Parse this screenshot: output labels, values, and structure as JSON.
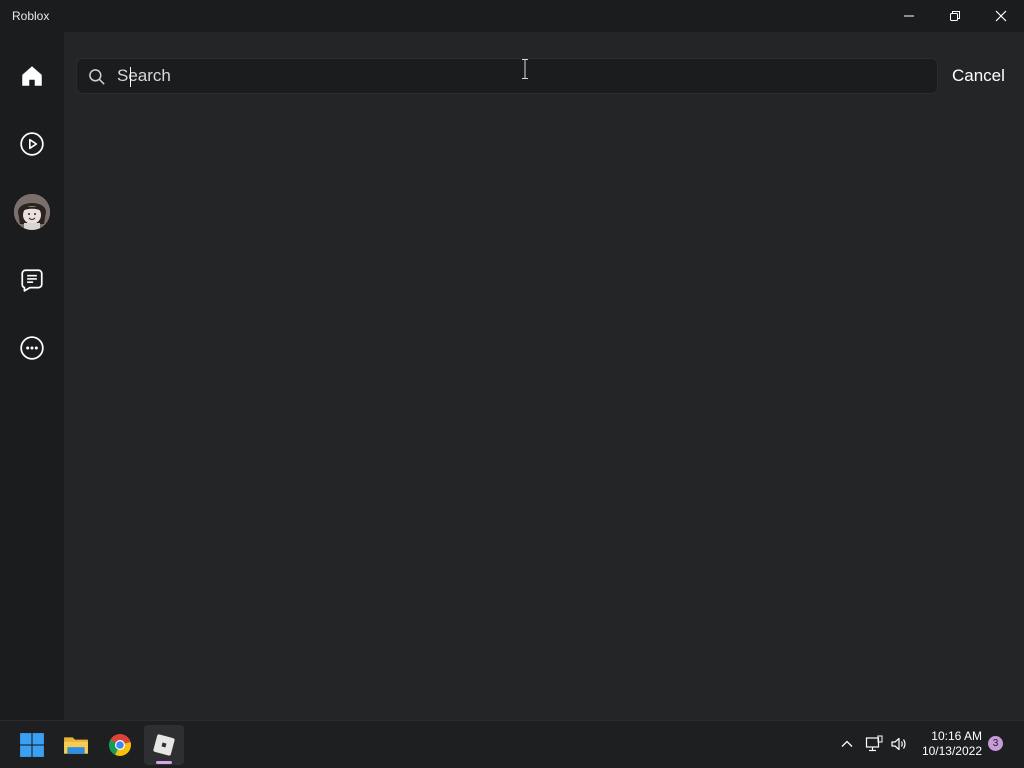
{
  "window": {
    "title": "Roblox",
    "controls": [
      "minimize-icon",
      "restore-icon",
      "close-icon"
    ]
  },
  "sidebar": {
    "items": [
      {
        "name": "home",
        "icon": "home-icon",
        "active": true
      },
      {
        "name": "play",
        "icon": "play-circle-icon"
      },
      {
        "name": "avatar",
        "icon": "avatar-icon"
      },
      {
        "name": "chat",
        "icon": "chat-icon"
      },
      {
        "name": "more",
        "icon": "more-icon"
      }
    ]
  },
  "search": {
    "placeholder": "Search",
    "value": "",
    "cancel_label": "Cancel"
  },
  "taskbar": {
    "apps": [
      "windows-start-icon",
      "file-explorer-icon",
      "chrome-icon",
      "roblox-icon"
    ],
    "active_app": "roblox",
    "tray_icons": [
      "chevron-up-icon",
      "network-icon",
      "volume-icon"
    ],
    "time": "10:16 AM",
    "date": "10/13/2022",
    "notification_count": "3"
  },
  "colors": {
    "background": "#232527",
    "sidebar": "#1b1c1e",
    "search_bg": "#1b1c1e",
    "text": "#ffffff",
    "accent_underline": "#d8a6e6"
  }
}
